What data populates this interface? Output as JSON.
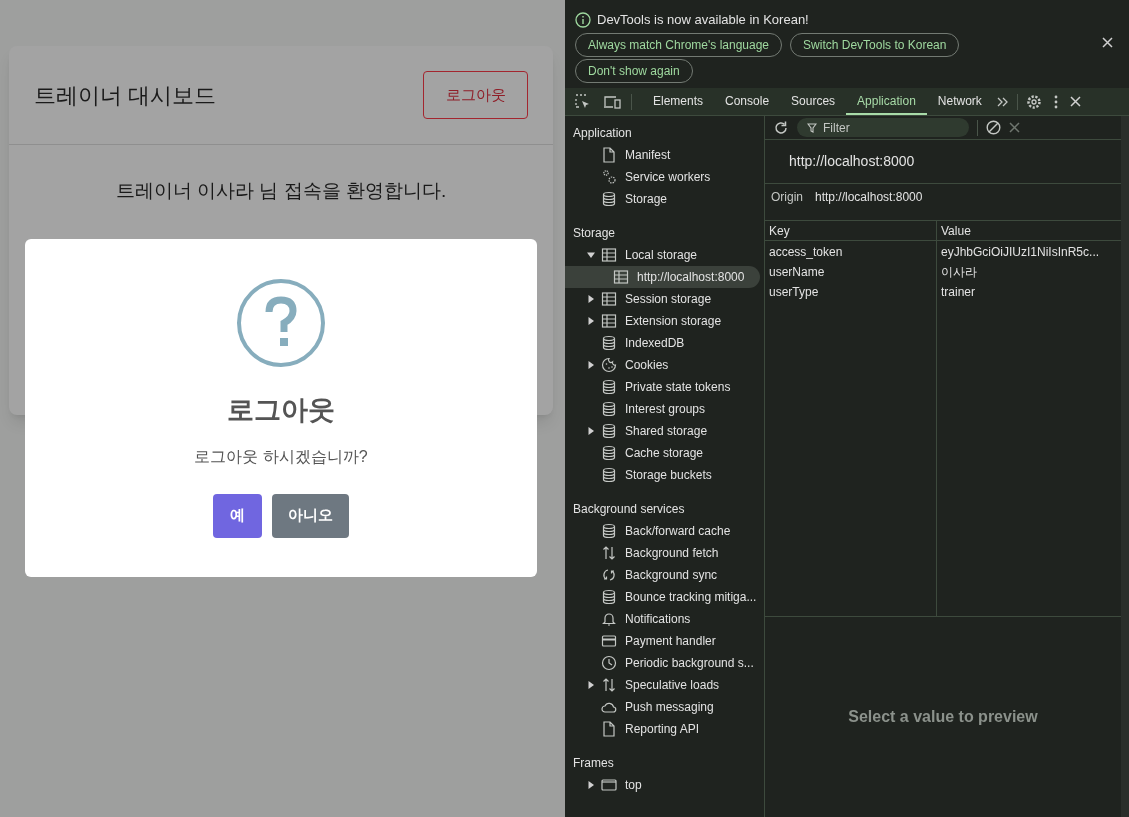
{
  "page": {
    "title": "트레이너 대시보드",
    "logout_button": "로그아웃",
    "welcome": "트레이너 이사라 님 접속을 환영합니다."
  },
  "dialog": {
    "title": "로그아웃",
    "message": "로그아웃 하시겠습니까?",
    "buttons": [
      {
        "label": "예",
        "kind": "confirm"
      },
      {
        "label": "아니오",
        "kind": "cancel"
      }
    ]
  },
  "devtools": {
    "infobar": {
      "message": "DevTools is now available in Korean!",
      "buttons": [
        "Always match Chrome's language",
        "Switch DevTools to Korean",
        "Don't show again"
      ]
    },
    "tabs": [
      {
        "label": "Elements",
        "selected": false
      },
      {
        "label": "Console",
        "selected": false
      },
      {
        "label": "Sources",
        "selected": false
      },
      {
        "label": "Application",
        "selected": true
      },
      {
        "label": "Network",
        "selected": false
      }
    ],
    "sidebar": [
      {
        "heading": "Application",
        "items": [
          {
            "label": "Manifest",
            "kind": "file",
            "selected": false
          },
          {
            "label": "Service workers",
            "kind": "gears",
            "selected": false
          },
          {
            "label": "Storage",
            "kind": "database",
            "selected": false
          }
        ]
      },
      {
        "heading": "Storage",
        "items": [
          {
            "label": "Local storage",
            "kind": "table",
            "selected": false,
            "expanded": true,
            "children": [
              {
                "label": "http://localhost:8000",
                "kind": "table",
                "selected": true
              }
            ]
          },
          {
            "label": "Session storage",
            "kind": "table",
            "selected": false,
            "expanded": false
          },
          {
            "label": "Extension storage",
            "kind": "table",
            "selected": false,
            "expanded": false
          },
          {
            "label": "IndexedDB",
            "kind": "database",
            "selected": false
          },
          {
            "label": "Cookies",
            "kind": "cookie",
            "selected": false,
            "expanded": false
          },
          {
            "label": "Private state tokens",
            "kind": "database",
            "selected": false
          },
          {
            "label": "Interest groups",
            "kind": "database",
            "selected": false
          },
          {
            "label": "Shared storage",
            "kind": "database",
            "selected": false,
            "expanded": false
          },
          {
            "label": "Cache storage",
            "kind": "database",
            "selected": false
          },
          {
            "label": "Storage buckets",
            "kind": "database",
            "selected": false
          }
        ]
      },
      {
        "heading": "Background services",
        "items": [
          {
            "label": "Back/forward cache",
            "kind": "database",
            "selected": false
          },
          {
            "label": "Background fetch",
            "kind": "updown",
            "selected": false
          },
          {
            "label": "Background sync",
            "kind": "sync",
            "selected": false
          },
          {
            "label": "Bounce tracking mitiga...",
            "kind": "database",
            "selected": false
          },
          {
            "label": "Notifications",
            "kind": "bell",
            "selected": false
          },
          {
            "label": "Payment handler",
            "kind": "card",
            "selected": false
          },
          {
            "label": "Periodic background s...",
            "kind": "clock",
            "selected": false
          },
          {
            "label": "Speculative loads",
            "kind": "updown",
            "selected": false,
            "expanded": false
          },
          {
            "label": "Push messaging",
            "kind": "cloud",
            "selected": false
          },
          {
            "label": "Reporting API",
            "kind": "file",
            "selected": false
          }
        ]
      },
      {
        "heading": "Frames",
        "items": [
          {
            "label": "top",
            "kind": "frame",
            "selected": false,
            "expanded": false
          }
        ]
      }
    ],
    "filter_placeholder": "Filter",
    "origin_title": "http://localhost:8000",
    "origin": {
      "label": "Origin",
      "value": "http://localhost:8000"
    },
    "table": {
      "columns": [
        "Key",
        "Value"
      ],
      "rows": [
        [
          "access_token",
          "eyJhbGciOiJIUzI1NiIsInR5c..."
        ],
        [
          "userName",
          "이사라"
        ],
        [
          "userType",
          "trainer"
        ]
      ]
    },
    "preview_hint": "Select a value to preview"
  }
}
